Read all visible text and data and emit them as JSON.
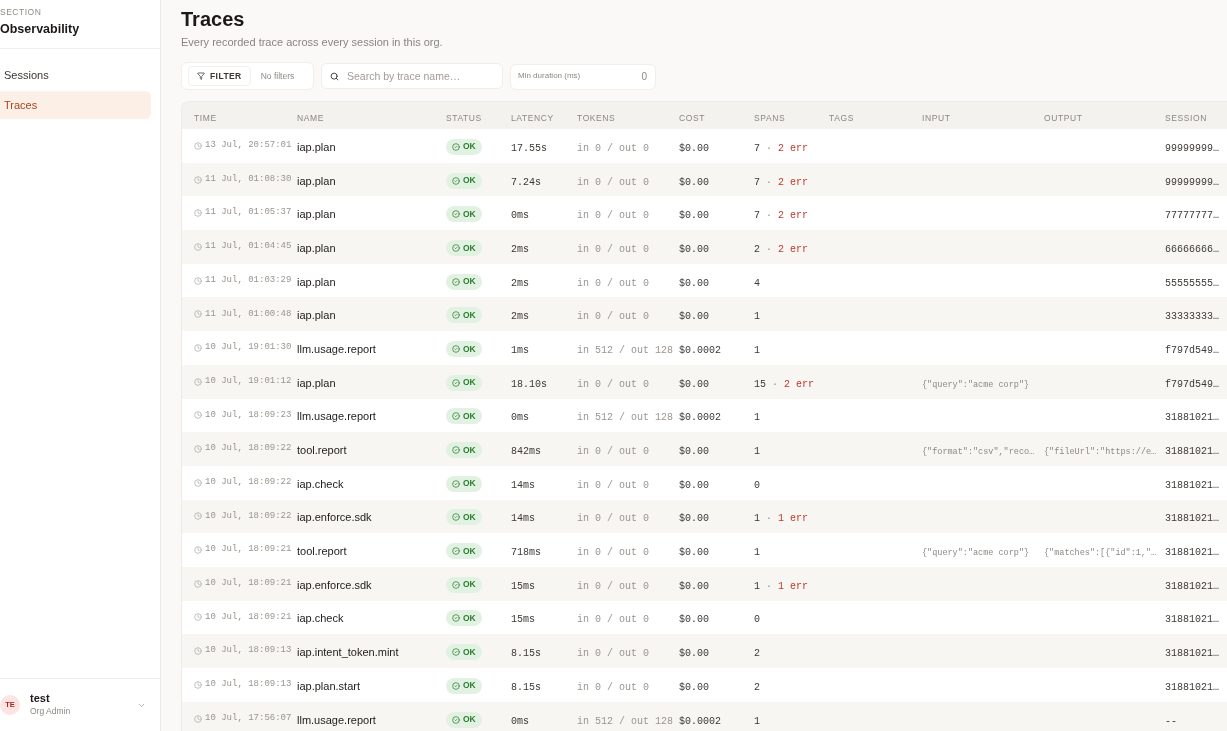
{
  "sidebar": {
    "section_label": "SECTION",
    "section_title": "Observability",
    "items": [
      {
        "label": "Sessions",
        "selected": false
      },
      {
        "label": "Traces",
        "selected": true
      }
    ],
    "user": {
      "initials": "TE",
      "name": "test",
      "role": "Org Admin"
    }
  },
  "page": {
    "title": "Traces",
    "subtitle": "Every recorded trace across every session in this org."
  },
  "filters": {
    "button": "FILTER",
    "status": "No filters",
    "search": {
      "placeholder": "Search by trace name…"
    },
    "min_duration": {
      "label": "Min duration (ms)",
      "value": "0"
    }
  },
  "table": {
    "columns": [
      "TIME",
      "NAME",
      "STATUS",
      "LATENCY",
      "TOKENS",
      "COST",
      "SPANS",
      "TAGS",
      "INPUT",
      "OUTPUT",
      "SESSION"
    ],
    "rows": [
      {
        "time": "13 Jul, 20:57:01",
        "name": "iap.plan",
        "status": "OK",
        "latency": "17.55s",
        "tokens": "in 0 / out 0",
        "cost": "$0.00",
        "spans": {
          "count": "7",
          "separator": "·",
          "errors": "2 err"
        },
        "session": "99999999…"
      },
      {
        "time": "11 Jul, 01:08:30",
        "name": "iap.plan",
        "status": "OK",
        "latency": "7.24s",
        "tokens": "in 0 / out 0",
        "cost": "$0.00",
        "spans": {
          "count": "7",
          "separator": "·",
          "errors": "2 err"
        },
        "session": "99999999…"
      },
      {
        "time": "11 Jul, 01:05:37",
        "name": "iap.plan",
        "status": "OK",
        "latency": "0ms",
        "tokens": "in 0 / out 0",
        "cost": "$0.00",
        "spans": {
          "count": "7",
          "separator": "·",
          "errors": "2 err"
        },
        "session": "77777777…"
      },
      {
        "time": "11 Jul, 01:04:45",
        "name": "iap.plan",
        "status": "OK",
        "latency": "2ms",
        "tokens": "in 0 / out 0",
        "cost": "$0.00",
        "spans": {
          "count": "2",
          "separator": "·",
          "errors": "2 err"
        },
        "session": "66666666…"
      },
      {
        "time": "11 Jul, 01:03:29",
        "name": "iap.plan",
        "status": "OK",
        "latency": "2ms",
        "tokens": "in 0 / out 0",
        "cost": "$0.00",
        "spans": {
          "count": "4"
        },
        "session": "55555555…"
      },
      {
        "time": "11 Jul, 01:00:48",
        "name": "iap.plan",
        "status": "OK",
        "latency": "2ms",
        "tokens": "in 0 / out 0",
        "cost": "$0.00",
        "spans": {
          "count": "1"
        },
        "session": "33333333…"
      },
      {
        "time": "10 Jul, 19:01:30",
        "name": "llm.usage.report",
        "status": "OK",
        "latency": "1ms",
        "tokens": "in 512 / out 128",
        "cost": "$0.0002",
        "spans": {
          "count": "1"
        },
        "session": "f797d549…"
      },
      {
        "time": "10 Jul, 19:01:12",
        "name": "iap.plan",
        "status": "OK",
        "latency": "18.10s",
        "tokens": "in 0 / out 0",
        "cost": "$0.00",
        "spans": {
          "count": "15",
          "separator": "·",
          "errors": "2 err"
        },
        "input": "{\"query\":\"acme corp\"}",
        "session": "f797d549…"
      },
      {
        "time": "10 Jul, 18:09:23",
        "name": "llm.usage.report",
        "status": "OK",
        "latency": "0ms",
        "tokens": "in 512 / out 128",
        "cost": "$0.0002",
        "spans": {
          "count": "1"
        },
        "session": "31881021…"
      },
      {
        "time": "10 Jul, 18:09:22",
        "name": "tool.report",
        "status": "OK",
        "latency": "842ms",
        "tokens": "in 0 / out 0",
        "cost": "$0.00",
        "spans": {
          "count": "1"
        },
        "input": "{\"format\":\"csv\",\"reco…",
        "output": "{\"fileUrl\":\"https://e…",
        "session": "31881021…"
      },
      {
        "time": "10 Jul, 18:09:22",
        "name": "iap.check",
        "status": "OK",
        "latency": "14ms",
        "tokens": "in 0 / out 0",
        "cost": "$0.00",
        "spans": {
          "count": "0"
        },
        "session": "31881021…"
      },
      {
        "time": "10 Jul, 18:09:22",
        "name": "iap.enforce.sdk",
        "status": "OK",
        "latency": "14ms",
        "tokens": "in 0 / out 0",
        "cost": "$0.00",
        "spans": {
          "count": "1",
          "separator": "·",
          "errors": "1 err"
        },
        "session": "31881021…"
      },
      {
        "time": "10 Jul, 18:09:21",
        "name": "tool.report",
        "status": "OK",
        "latency": "718ms",
        "tokens": "in 0 / out 0",
        "cost": "$0.00",
        "spans": {
          "count": "1"
        },
        "input": "{\"query\":\"acme corp\"}",
        "output": "{\"matches\":[{\"id\":1,\"…",
        "session": "31881021…"
      },
      {
        "time": "10 Jul, 18:09:21",
        "name": "iap.enforce.sdk",
        "status": "OK",
        "latency": "15ms",
        "tokens": "in 0 / out 0",
        "cost": "$0.00",
        "spans": {
          "count": "1",
          "separator": "·",
          "errors": "1 err"
        },
        "session": "31881021…"
      },
      {
        "time": "10 Jul, 18:09:21",
        "name": "iap.check",
        "status": "OK",
        "latency": "15ms",
        "tokens": "in 0 / out 0",
        "cost": "$0.00",
        "spans": {
          "count": "0"
        },
        "session": "31881021…"
      },
      {
        "time": "10 Jul, 18:09:13",
        "name": "iap.intent_token.mint",
        "status": "OK",
        "latency": "8.15s",
        "tokens": "in 0 / out 0",
        "cost": "$0.00",
        "spans": {
          "count": "2"
        },
        "session": "31881021…"
      },
      {
        "time": "10 Jul, 18:09:13",
        "name": "iap.plan.start",
        "status": "OK",
        "latency": "8.15s",
        "tokens": "in 0 / out 0",
        "cost": "$0.00",
        "spans": {
          "count": "2"
        },
        "session": "31881021…"
      },
      {
        "time": "10 Jul, 17:56:07",
        "name": "llm.usage.report",
        "status": "OK",
        "latency": "0ms",
        "tokens": "in 512 / out 128",
        "cost": "$0.0002",
        "spans": {
          "count": "1"
        },
        "session": "--"
      }
    ]
  }
}
